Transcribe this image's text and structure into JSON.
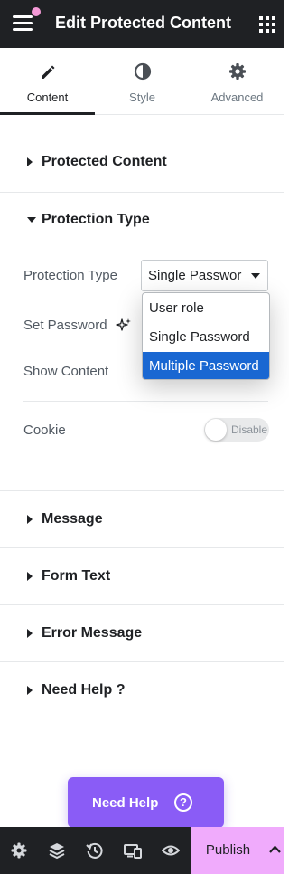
{
  "header": {
    "title": "Edit Protected Content"
  },
  "tabs": [
    {
      "label": "Content",
      "icon": "pencil-icon",
      "active": true
    },
    {
      "label": "Style",
      "icon": "half-circle-icon",
      "active": false
    },
    {
      "label": "Advanced",
      "icon": "gear-icon",
      "active": false
    }
  ],
  "sections": {
    "protected_content": "Protected Content",
    "protection_type": "Protection Type",
    "message": "Message",
    "form_text": "Form Text",
    "error_message": "Error Message",
    "need_help": "Need Help ?"
  },
  "controls": {
    "protection_type_label": "Protection Type",
    "protection_type_value": "Single Passwor",
    "set_password_label": "Set Password",
    "show_content_label": "Show Content",
    "cookie_label": "Cookie",
    "cookie_toggle_text": "Disable"
  },
  "dropdown": {
    "options": [
      "User role",
      "Single Password",
      "Multiple Password"
    ],
    "selected": "Multiple Password"
  },
  "need_help_button": {
    "label": "Need Help"
  },
  "footer": {
    "publish_label": "Publish"
  },
  "colors": {
    "header_bg": "#1f2124",
    "accent_purple": "#8a5cf6",
    "publish_pink": "#f0abfc",
    "selection_blue": "#1967d2"
  }
}
